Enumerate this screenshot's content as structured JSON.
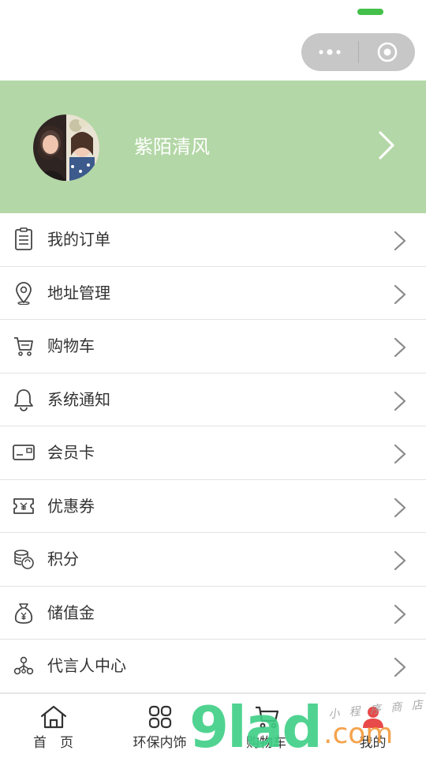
{
  "profile": {
    "username": "紫陌清风"
  },
  "menu": {
    "items": [
      {
        "label": "我的订单",
        "icon": "order-list-icon"
      },
      {
        "label": "地址管理",
        "icon": "location-pin-icon"
      },
      {
        "label": "购物车",
        "icon": "cart-icon"
      },
      {
        "label": "系统通知",
        "icon": "bell-icon"
      },
      {
        "label": "会员卡",
        "icon": "member-card-icon"
      },
      {
        "label": "优惠券",
        "icon": "coupon-icon"
      },
      {
        "label": "积分",
        "icon": "points-coins-icon"
      },
      {
        "label": "储值金",
        "icon": "money-bag-icon"
      },
      {
        "label": "代言人中心",
        "icon": "network-icon"
      }
    ]
  },
  "tabbar": {
    "tabs": [
      {
        "label": "首　页",
        "icon": "home-icon"
      },
      {
        "label": "环保内饰",
        "icon": "grid-icon"
      },
      {
        "label": "购物车",
        "icon": "cart-tab-icon"
      },
      {
        "label": "我的",
        "icon": "user-icon",
        "active": true
      }
    ]
  },
  "watermark": {
    "number": "9lad",
    "domain": ".com",
    "handwriting": "小 程 序 商 店"
  },
  "colors": {
    "profile_bg": "#b3d7a6",
    "top_indicator": "#44c04a",
    "capsule_bg": "#c7c7c7",
    "active_user": "#e84a4a"
  }
}
